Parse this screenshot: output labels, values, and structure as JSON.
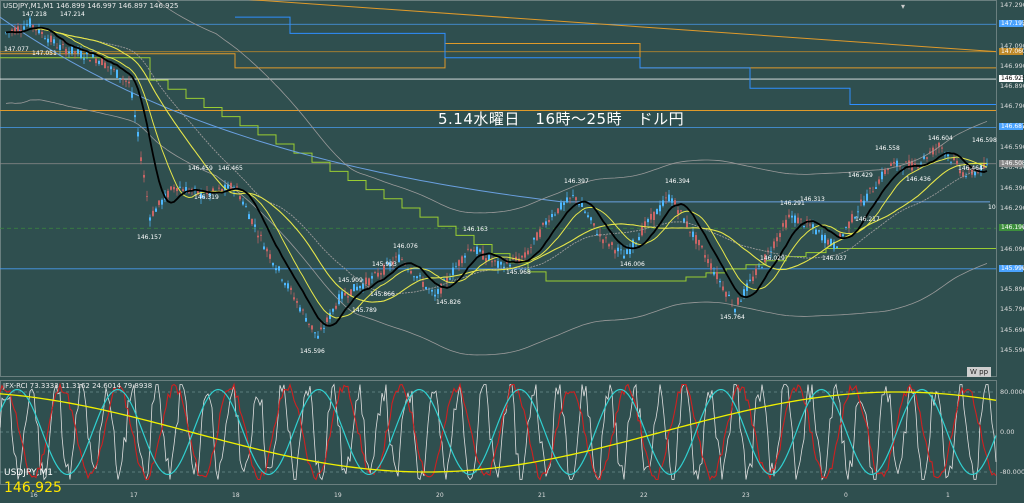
{
  "header": {
    "main_info": "USDJPY,M1,M1   146.899  146.997  146.897  146.925",
    "osc_info": "JFX-RCI 73.3333  11.3162  24.6014  79.8938"
  },
  "title": "5.14水曜日　16時～25時　ドル円",
  "symbol_label": "USDJPY,M1",
  "current_price": "146.925",
  "wpp_label": "W pp",
  "price_axis": [
    "147.290",
    "147.190",
    "147.090",
    "146.990",
    "146.890",
    "146.790",
    "146.690",
    "146.590",
    "146.490",
    "146.390",
    "146.290",
    "146.190",
    "146.090",
    "145.990",
    "145.890",
    "145.790",
    "145.690",
    "145.590"
  ],
  "price_tags": [
    {
      "text": "147.195",
      "color": "#4aa3ff"
    },
    {
      "text": "147.060",
      "color": "#c08a2a"
    },
    {
      "text": "146.925",
      "color": "#ffffff"
    },
    {
      "text": "146.687",
      "color": "#4aa3ff"
    },
    {
      "text": "146.508",
      "color": "#888888"
    },
    {
      "text": "146.190",
      "color": "#3d8f3d"
    },
    {
      "text": "145.990",
      "color": "#4aa3ff"
    }
  ],
  "osc_axis": [
    "80.0000",
    "0.00",
    "-80.0000"
  ],
  "time_ticks": [
    "16",
    "17",
    "18",
    "19",
    "20",
    "21",
    "22",
    "23",
    "0",
    "1"
  ],
  "price_annotations": [
    {
      "text": "147.218"
    },
    {
      "text": "147.214"
    },
    {
      "text": "147.051"
    },
    {
      "text": "147.077"
    },
    {
      "text": "146.459"
    },
    {
      "text": "146.465"
    },
    {
      "text": "146.319"
    },
    {
      "text": "146.157"
    },
    {
      "text": "145.909"
    },
    {
      "text": "145.993"
    },
    {
      "text": "146.076"
    },
    {
      "text": "145.789"
    },
    {
      "text": "145.866"
    },
    {
      "text": "145.826"
    },
    {
      "text": "145.596"
    },
    {
      "text": "146.163"
    },
    {
      "text": "145.968"
    },
    {
      "text": "146.006"
    },
    {
      "text": "146.397"
    },
    {
      "text": "146.394"
    },
    {
      "text": "145.764"
    },
    {
      "text": "146.291"
    },
    {
      "text": "146.313"
    },
    {
      "text": "146.029"
    },
    {
      "text": "146.037"
    },
    {
      "text": "146.217"
    },
    {
      "text": "146.429"
    },
    {
      "text": "146.558"
    },
    {
      "text": "146.604"
    },
    {
      "text": "146.436"
    },
    {
      "text": "146.464"
    },
    {
      "text": "146.598"
    },
    {
      "text": "10"
    }
  ],
  "colors": {
    "background": "#2f4f4f",
    "bull": "#4db8ff",
    "bear": "#c86464",
    "ma_black": "#000000",
    "ma_yellow": "#e6e64a",
    "ma_green": "#9acd32",
    "ma_blue": "#6aa0e0",
    "pivot_orange": "#e09a2a",
    "pivot_blue": "#2f8fff",
    "band_gray": "#9a9a9a",
    "osc_yellow": "#f0f000",
    "osc_cyan": "#30d0d0",
    "osc_red": "#d02020",
    "osc_white": "#e0e0e0"
  }
}
